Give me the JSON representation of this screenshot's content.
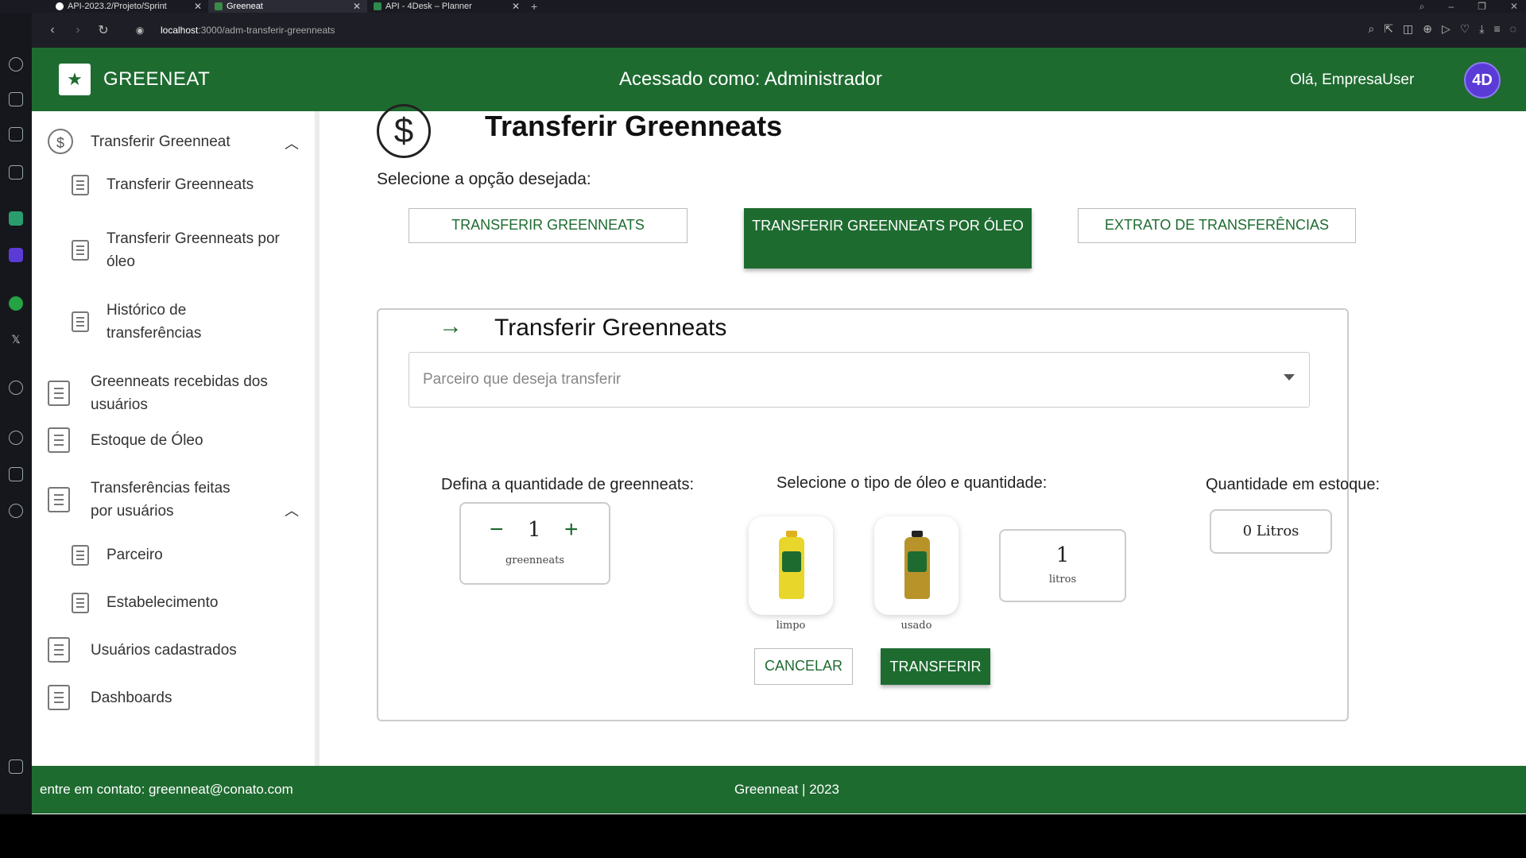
{
  "browser": {
    "tabs": [
      {
        "label": "API-2023.2/Projeto/Sprint"
      },
      {
        "label": "Greeneat"
      },
      {
        "label": "API - 4Desk – Planner"
      }
    ],
    "url_host": "localhost",
    "url_path": ":3000/adm-transferir-greenneats"
  },
  "header": {
    "brand": "GREENEAT",
    "accessed": "Acessado como: Administrador",
    "hello": "Olá, EmpresaUser",
    "avatar": "4D"
  },
  "sidebar": {
    "items": [
      {
        "label": "Transferir Greenneat"
      },
      {
        "label": "Transferir Greenneats"
      },
      {
        "label": "Transferir Greenneats por óleo"
      },
      {
        "label": "Histórico de transferências"
      },
      {
        "label": "Greenneats recebidas dos usuários"
      },
      {
        "label": "Estoque de Óleo"
      },
      {
        "label": "Transferências feitas por usuários"
      },
      {
        "label": "Parceiro"
      },
      {
        "label": "Estabelecimento"
      },
      {
        "label": "Usuários cadastrados"
      },
      {
        "label": "Dashboards"
      }
    ]
  },
  "main": {
    "title": "Transferir Greenneats",
    "select_label": "Selecione a opção desejada:",
    "options": [
      {
        "label": "TRANSFERIR GREENNEATS"
      },
      {
        "label": "TRANSFERIR GREENNEATS POR ÓLEO"
      },
      {
        "label": "EXTRATO DE TRANSFERÊNCIAS"
      }
    ],
    "active_option": "TRANSFERIR GREENNEATS POR ÓLEO",
    "card": {
      "title": "Transferir Greenneats",
      "partner_placeholder": "Parceiro que deseja transferir",
      "qty_label": "Defina a quantidade de greenneats:",
      "qty_value": "1",
      "qty_unit": "greenneats",
      "oil_label": "Selecione o tipo de óleo e quantidade:",
      "oil_types": [
        {
          "name": "limpo",
          "color": "#e9d62a"
        },
        {
          "name": "usado",
          "color": "#b8932a"
        }
      ],
      "liters_value": "1",
      "liters_unit": "litros",
      "stock_label": "Quantidade em estoque:",
      "stock_value": "0 Litros",
      "cancel": "CANCELAR",
      "transfer": "TRANSFERIR"
    }
  },
  "footer": {
    "contact": "entre em contato: greenneat@conato.com",
    "copyright": "Greenneat | 2023"
  },
  "colors": {
    "primary": "#1e6b30"
  }
}
